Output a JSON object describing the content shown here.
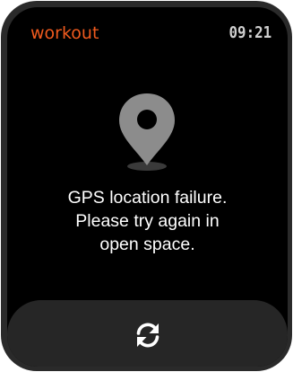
{
  "header": {
    "title": "workout",
    "time": "09:21"
  },
  "message": {
    "line1": "GPS location failure.",
    "line2": "Please try again in",
    "line3": "open space."
  },
  "icons": {
    "status": "location-pin-icon",
    "action": "refresh-icon"
  },
  "colors": {
    "accent": "#f05a1e",
    "background": "#000000",
    "button": "#262626",
    "icon": "#8c8c8c"
  }
}
